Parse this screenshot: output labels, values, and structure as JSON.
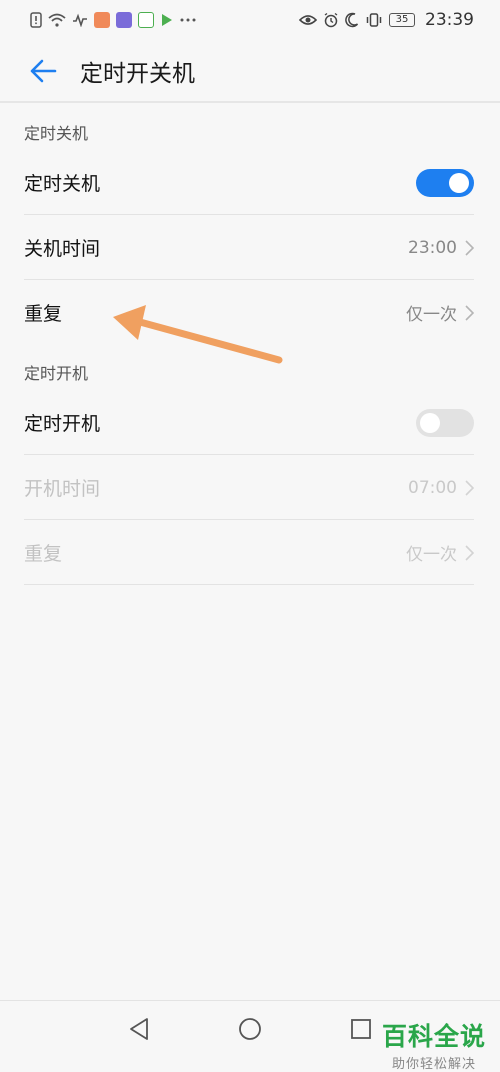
{
  "status_bar": {
    "time": "23:39",
    "battery": "35",
    "left_icons": [
      "sim-alert-icon",
      "wifi-icon",
      "activity-icon",
      "app-orange-icon",
      "app-purple-icon",
      "app-green-icon",
      "app-play-icon",
      "more-dots-icon"
    ],
    "right_icons": [
      "eye-icon",
      "alarm-icon",
      "moon-icon",
      "vibrate-icon",
      "battery-icon"
    ]
  },
  "app_bar": {
    "title": "定时开关机"
  },
  "sections": {
    "shutdown": {
      "header": "定时关机",
      "toggle_label": "定时关机",
      "toggle_on": true,
      "time_label": "关机时间",
      "time_value": "23:00",
      "repeat_label": "重复",
      "repeat_value": "仅一次"
    },
    "boot": {
      "header": "定时开机",
      "toggle_label": "定时开机",
      "toggle_on": false,
      "time_label": "开机时间",
      "time_value": "07:00",
      "repeat_label": "重复",
      "repeat_value": "仅一次"
    }
  },
  "colors": {
    "accent": "#1e7ff0",
    "annotation_arrow": "#f0a060",
    "watermark": "#2aa64a"
  },
  "watermark": {
    "title": "百科全说",
    "subtitle": "助你轻松解决"
  },
  "nav_bar": {
    "icons": [
      "nav-back-icon",
      "nav-home-icon",
      "nav-recents-icon"
    ]
  }
}
